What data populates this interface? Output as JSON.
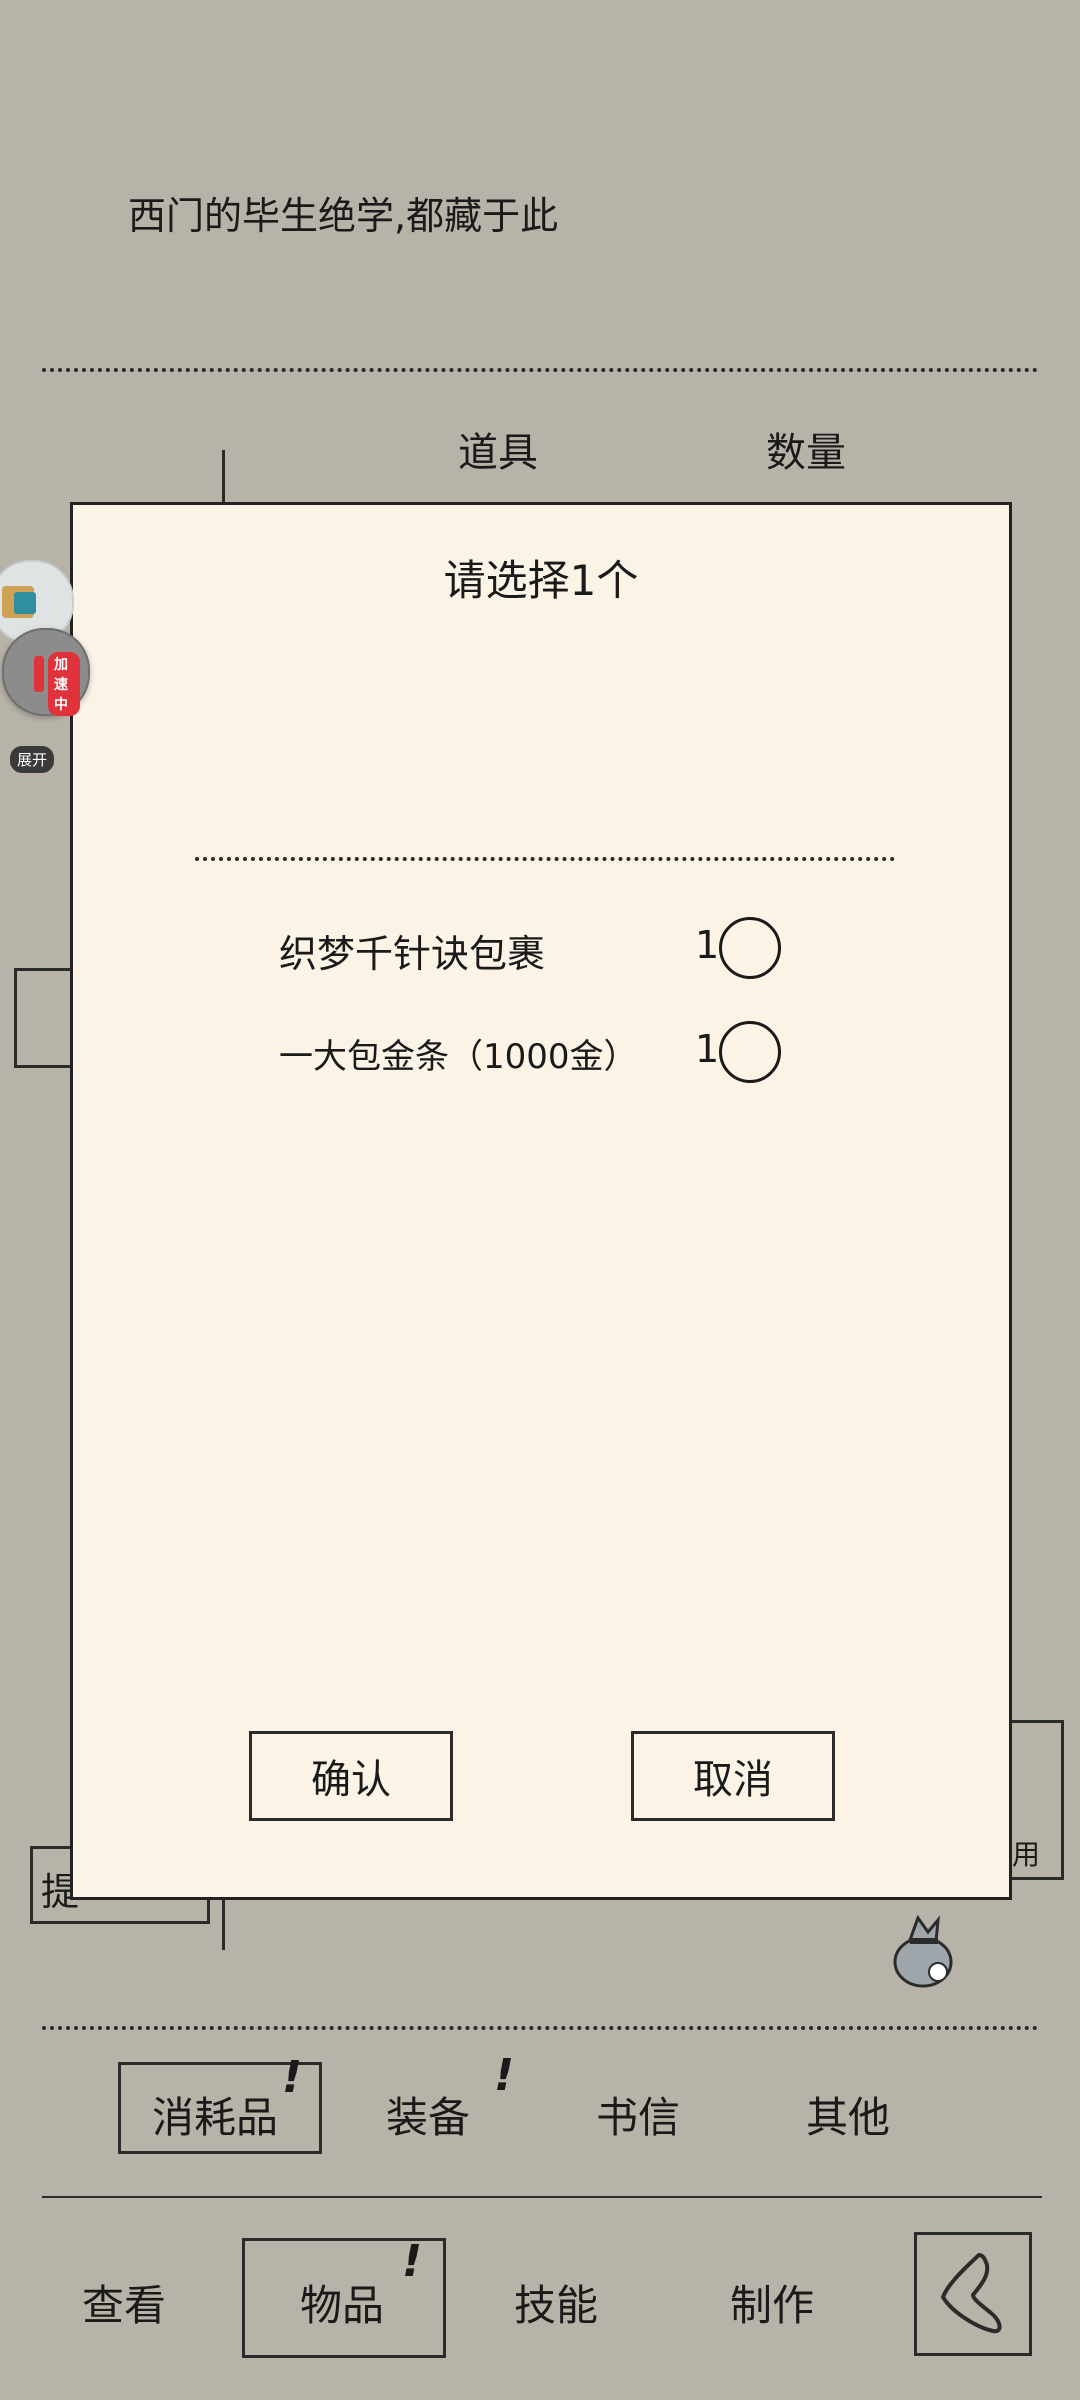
{
  "page": {
    "description": "西门的毕生绝学,都藏于此",
    "table_headers": {
      "item": "道具",
      "quantity": "数量"
    },
    "partial_left_label": "提",
    "partial_right_label": "用"
  },
  "overlay": {
    "badge": "加速中",
    "expand": "展开"
  },
  "dialog": {
    "title": "请选择1个",
    "options": [
      {
        "name": "织梦千针诀包裹",
        "count": "1",
        "selected": false
      },
      {
        "name": "一大包金条（1000金）",
        "count": "1",
        "selected": false
      }
    ],
    "confirm": "确认",
    "cancel": "取消"
  },
  "item_tabs": [
    {
      "label": "消耗品",
      "active": true,
      "alert": "!"
    },
    {
      "label": "装备",
      "active": false,
      "alert": "!"
    },
    {
      "label": "书信",
      "active": false,
      "alert": ""
    },
    {
      "label": "其他",
      "active": false,
      "alert": ""
    }
  ],
  "main_nav": [
    {
      "label": "查看",
      "active": false,
      "alert": ""
    },
    {
      "label": "物品",
      "active": true,
      "alert": "!"
    },
    {
      "label": "技能",
      "active": false,
      "alert": ""
    },
    {
      "label": "制作",
      "active": false,
      "alert": ""
    }
  ],
  "icons": {
    "back": "back-arrow-icon",
    "money_bag": "money-bag-icon"
  }
}
